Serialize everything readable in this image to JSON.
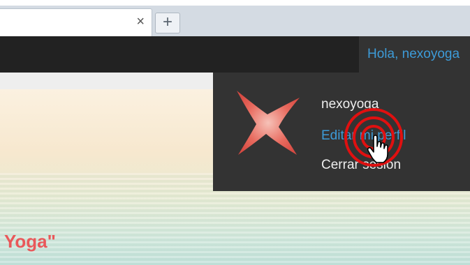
{
  "browser": {
    "active_tab": {
      "title": "",
      "close_icon": "×"
    },
    "new_tab_icon": "+"
  },
  "admin_bar": {
    "greeting": "Hola, nexoyoga"
  },
  "account_menu": {
    "username": "nexoyoga",
    "edit_profile": "Editar mi perfil",
    "logout": "Cerrar sesión"
  },
  "hero": {
    "title_fragment": "Yoga\""
  },
  "colors": {
    "admin_bar_bg": "#222222",
    "dropdown_bg": "#333333",
    "link_blue": "#3d9bd8",
    "hero_title": "#e9585a",
    "click_ring": "#e01010"
  },
  "icons": [
    "close-icon",
    "plus-icon",
    "star-avatar-icon",
    "lotus-logo-icon",
    "hand-cursor-icon",
    "click-indicator-icon"
  ]
}
